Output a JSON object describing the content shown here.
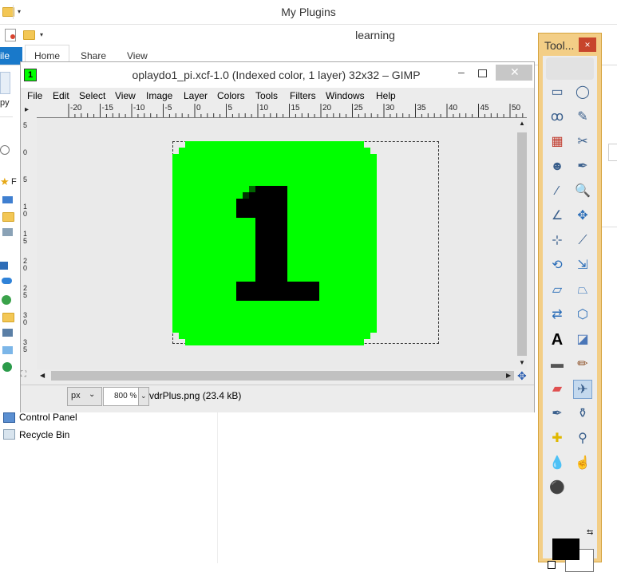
{
  "explorer_back": {
    "title": "My Plugins"
  },
  "explorer_front": {
    "title": "learning",
    "tabs": [
      "Home",
      "Share",
      "View"
    ],
    "file_tab": "ile",
    "copy_label": "py"
  },
  "left_nav": [
    {
      "label": "Control Panel",
      "icon": "control-panel-icon"
    },
    {
      "label": "Recycle Bin",
      "icon": "recycle-bin-icon"
    }
  ],
  "gimp": {
    "badge": "1",
    "title": "oplaydo1_pi.xcf-1.0 (Indexed color, 1 layer) 32x32 – GIMP",
    "menus": [
      "File",
      "Edit",
      "Select",
      "View",
      "Image",
      "Layer",
      "Colors",
      "Tools",
      "Filters",
      "Windows",
      "Help"
    ],
    "ruler_top_labels": [
      "-20",
      "-15",
      "-10",
      "-5",
      "0",
      "5",
      "10",
      "15",
      "20",
      "25",
      "30",
      "35",
      "40",
      "45",
      "50"
    ],
    "ruler_left_labels": [
      "5",
      "0",
      "5",
      "1\n0",
      "1\n5",
      "2\n0",
      "2\n5",
      "3\n0",
      "3\n5"
    ],
    "unit": "px",
    "zoom": "800 %",
    "status": "vdrPlus.png (23.4 kB)"
  },
  "toolbox": {
    "title": "Tool...",
    "close": "×",
    "tools": [
      "rect-select-icon",
      "ellipse-select-icon",
      "free-select-icon",
      "fuzzy-select-icon",
      "by-color-select-icon",
      "scissors-icon",
      "foreground-select-icon",
      "paths-icon",
      "color-picker-icon",
      "zoom-icon",
      "measure-icon",
      "move-icon",
      "align-icon",
      "crop-icon",
      "rotate-icon",
      "scale-icon",
      "shear-icon",
      "perspective-icon",
      "flip-icon",
      "cage-icon",
      "text-icon",
      "bucket-fill-icon",
      "blend-icon",
      "pencil-icon",
      "eraser-icon",
      "airbrush-icon",
      "ink-icon",
      "clone-icon",
      "heal-icon",
      "perspective-clone-icon",
      "blur-icon",
      "smudge-icon",
      "dodge-burn-icon"
    ],
    "active_tool": "airbrush-icon",
    "fg_color": "#000000",
    "bg_color": "#ffffff"
  }
}
